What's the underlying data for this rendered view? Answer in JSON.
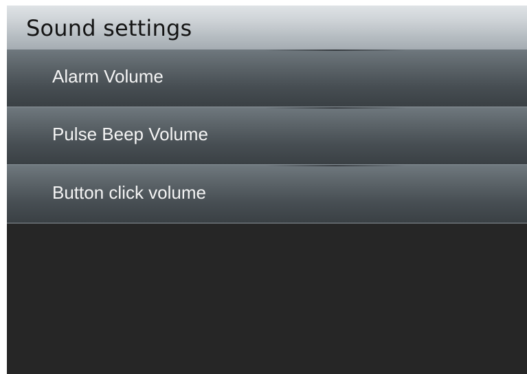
{
  "header": {
    "title": "Sound settings"
  },
  "menu": {
    "items": [
      {
        "label": "Alarm Volume"
      },
      {
        "label": "Pulse Beep Volume"
      },
      {
        "label": "Button click volume"
      }
    ]
  },
  "colors": {
    "header_bg": "#cdd2d6",
    "item_bg": "#545c61",
    "screen_bg": "#262626",
    "text_light": "#f4f4f4",
    "text_dark": "#141414"
  }
}
